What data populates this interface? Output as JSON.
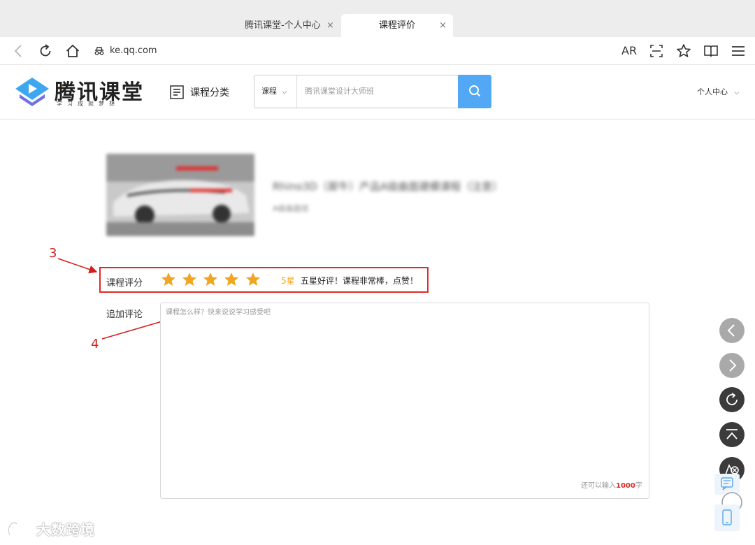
{
  "browser": {
    "tabs": [
      {
        "title": "腾讯课堂-个人中心",
        "close": "×"
      },
      {
        "title": "课程评价",
        "close": "×"
      }
    ],
    "url": "ke.qq.com",
    "ar_label": "AR"
  },
  "header": {
    "logo_text": "腾讯课堂",
    "slogan": "学习成就梦想",
    "category_label": "课程分类",
    "search_type": "课程",
    "search_placeholder": "腾讯课堂设计大师班",
    "user_center": "个人中心"
  },
  "course": {
    "title": "Rhino3D（犀牛）产品A级曲面建模课程（注意）",
    "subtitle": "A级曲面班"
  },
  "rating": {
    "label": "课程评分",
    "stars": 5,
    "max_stars": 5,
    "score_text": "5星",
    "description": "五星好评！课程非常棒，点赞！"
  },
  "comment": {
    "label": "追加评论",
    "placeholder": "课程怎么样？快来说说学习感受吧",
    "remaining_prefix": "还可以输入",
    "remaining_count": "1000",
    "remaining_suffix": "字"
  },
  "annotations": [
    "3",
    "4"
  ],
  "watermark": "大数跨境",
  "colors": {
    "accent_blue": "#52a8f4",
    "star": "#f0a623",
    "annotation_red": "#e02a2a"
  }
}
